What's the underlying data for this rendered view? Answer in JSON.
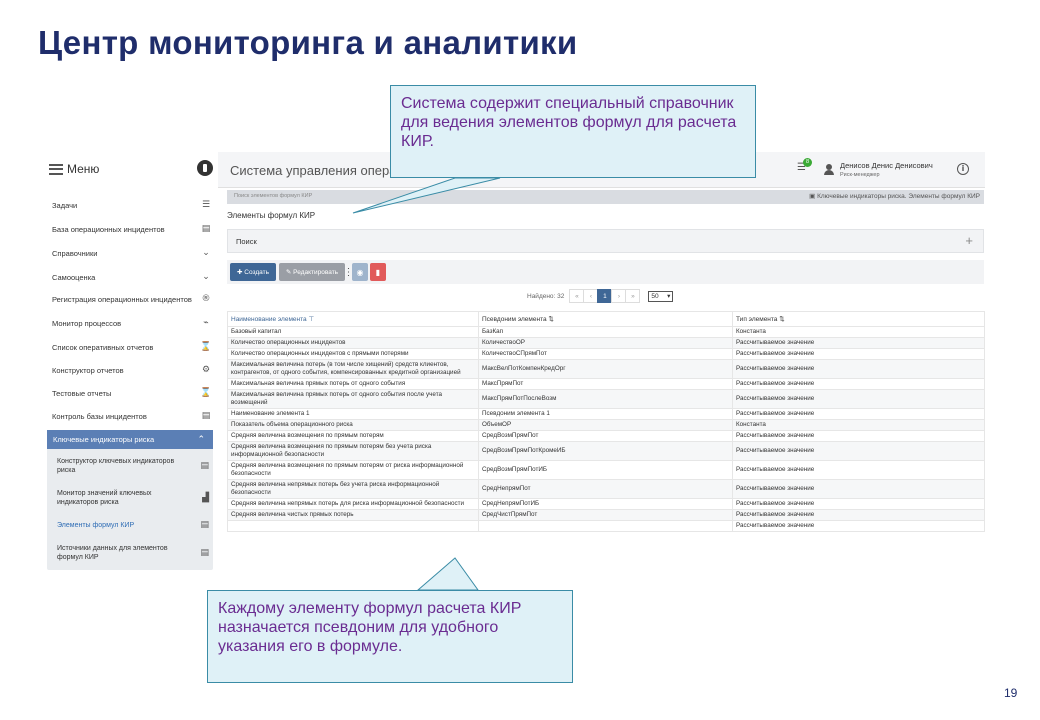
{
  "slide": {
    "title": "Центр мониторинга и аналитики",
    "number": "19"
  },
  "sidebar": {
    "menu_label": "Меню",
    "items": [
      {
        "label": "Задачи",
        "icon": "list-check-icon"
      },
      {
        "label": "База операционных инцидентов",
        "icon": "table-icon"
      },
      {
        "label": "Справочники",
        "icon": "chevron-down-icon"
      },
      {
        "label": "Самооценка",
        "icon": "chevron-down-icon"
      },
      {
        "label": "Регистрация операционных инцидентов",
        "icon": "registered-icon"
      },
      {
        "label": "Монитор процессов",
        "icon": "pulse-icon"
      },
      {
        "label": "Список оперативных отчетов",
        "icon": "hourglass-icon"
      },
      {
        "label": "Конструктор отчетов",
        "icon": "gears-icon"
      },
      {
        "label": "Тестовые отчеты",
        "icon": "hourglass-icon"
      },
      {
        "label": "Контроль базы инцидентов",
        "icon": "table-icon"
      }
    ],
    "kir_group": {
      "label": "Ключевые индикаторы риска",
      "items": [
        {
          "label": "Конструктор ключевых индикаторов риска",
          "icon": "table-icon"
        },
        {
          "label": "Монитор значений ключевых индикаторов риска",
          "icon": "chart-icon"
        },
        {
          "label": "Элементы формул КИР",
          "icon": "document-icon"
        },
        {
          "label": "Источники данных для элементов формул КИР",
          "icon": "document-icon"
        }
      ]
    }
  },
  "header": {
    "app_title": "Система управления операционными",
    "notification_count": "8",
    "user_name": "Денисов Денис Денисович",
    "user_role": "Риск-менеджер"
  },
  "breadcrumb": {
    "left": "Поиск элементов формул КИР",
    "right": "Ключевые индикаторы риска. Элементы формул КИР"
  },
  "page": {
    "title": "Элементы формул КИР",
    "search_label": "Поиск"
  },
  "toolbar": {
    "create_label": "Создать",
    "edit_label": "Редактировать"
  },
  "pagination": {
    "found_text": "Найдено: 32",
    "current_page": "1",
    "page_size": "50"
  },
  "table": {
    "columns": [
      "Наименование элемента",
      "Псевдоним элемента",
      "Тип элемента"
    ],
    "rows": [
      {
        "name": "Базовый капитал",
        "alias": "БазКап",
        "type": "Константа"
      },
      {
        "name": "Количество операционных инцидентов",
        "alias": "КоличествоОР",
        "type": "Рассчитываемое значение"
      },
      {
        "name": "Количество операционных инцидентов с прямыми потерями",
        "alias": "КоличествоСПрямПот",
        "type": "Рассчитываемое значение"
      },
      {
        "name": "Максимальная величина потерь (в том числе хищений) средств клиентов, контрагентов, от одного события, компенсированных кредитной организацией",
        "alias": "МаксВелПотКомпенКредОрг",
        "type": "Рассчитываемое значение"
      },
      {
        "name": "Максимальная величина прямых потерь от одного события",
        "alias": "МаксПрямПот",
        "type": "Рассчитываемое значение"
      },
      {
        "name": "Максимальная величина прямых потерь от одного события после учета возмещений",
        "alias": "МаксПрямПотПослеВозм",
        "type": "Рассчитываемое значение"
      },
      {
        "name": "Наименование элемента 1",
        "alias": "Псевдоним элемента 1",
        "type": "Рассчитываемое значение"
      },
      {
        "name": "Показатель объема операционного риска",
        "alias": "ОбъемОР",
        "type": "Константа"
      },
      {
        "name": "Средняя величина возмещения по прямым потерям",
        "alias": "СредВозмПрямПот",
        "type": "Рассчитываемое значение"
      },
      {
        "name": "Средняя величина возмещения по прямым потерям без учета риска информационной безопасности",
        "alias": "СредВозмПрямПотКромеИБ",
        "type": "Рассчитываемое значение"
      },
      {
        "name": "Средняя величина возмещения по прямым потерям от риска информационной безопасности",
        "alias": "СредВозмПрямПотИБ",
        "type": "Рассчитываемое значение"
      },
      {
        "name": "Средняя величина непрямых потерь без учета риска информационной безопасности",
        "alias": "СредНепрямПот",
        "type": "Рассчитываемое значение"
      },
      {
        "name": "Средняя величина непрямых потерь для риска информационной безопасности",
        "alias": "СредНепрямПотИБ",
        "type": "Рассчитываемое значение"
      },
      {
        "name": "Средняя величина чистых прямых потерь",
        "alias": "СредЧистПрямПот",
        "type": "Рассчитываемое значение"
      },
      {
        "name": "",
        "alias": "",
        "type": "Рассчитываемое значение"
      }
    ]
  },
  "callouts": {
    "top": "Система содержит специальный справочник для ведения элементов формул для расчета КИР.",
    "bottom": "Каждому элементу формул расчета КИР назначается псевдоним для удобного указания его в формуле."
  },
  "colors": {
    "title": "#1f2d6b",
    "accent": "#3f6796",
    "sidebar_active": "#5b7fb5",
    "callout_bg": "#dff1f7",
    "callout_border": "#3a8ca6",
    "callout_text": "#6a2c91",
    "delete": "#e15a5a"
  }
}
